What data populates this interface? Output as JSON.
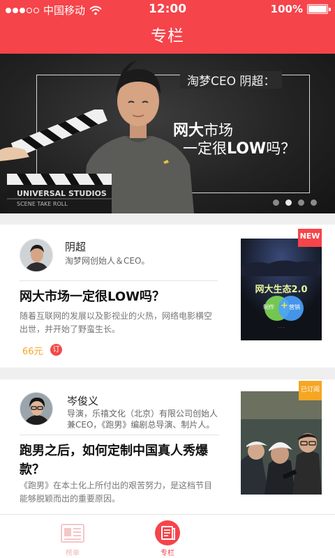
{
  "status_bar": {
    "carrier": "中国移动",
    "time": "12:00",
    "battery": "100%"
  },
  "nav": {
    "title": "专栏"
  },
  "banner": {
    "overline": "淘梦CEO 阴超：",
    "headline_line1_bold": "网大",
    "headline_line1_rest": "市场",
    "headline_line2_pre": "一定很",
    "headline_line2_bold": "LOW",
    "headline_line2_post": "吗？",
    "page_count": 4,
    "active_page": 1
  },
  "articles": [
    {
      "author": "阴超",
      "role": "淘梦网创始人＆CEO。",
      "title": "网大市场一定很LOW吗？",
      "desc": "随着互联网的发展以及影视业的火热，网络电影横空出世，并开始了野蛮生长。",
      "price": "66元",
      "subscribe_label": "订",
      "ribbon": "NEW",
      "thumb_title": "网大生态2.0",
      "thumb_left": "制作",
      "thumb_plus": "+",
      "thumb_right": "营销"
    },
    {
      "author": "岑俊义",
      "role": "导演，乐禧文化（北京）有限公司创始人兼CEO，《跑男》编剧总导演、制片人。",
      "title": "跑男之后，如何定制中国真人秀爆款？",
      "desc": "《跑男》在本土化上所付出的艰苦努力，是这档节目能够脱颖而出的重要原因。",
      "ribbon": "已订阅"
    }
  ],
  "tabbar": {
    "tab1": "榜单",
    "tab2": "专栏"
  },
  "colors": {
    "brand_red": "#f5444a",
    "price_orange": "#f5a623",
    "ribbon_orange": "#f5a623"
  }
}
